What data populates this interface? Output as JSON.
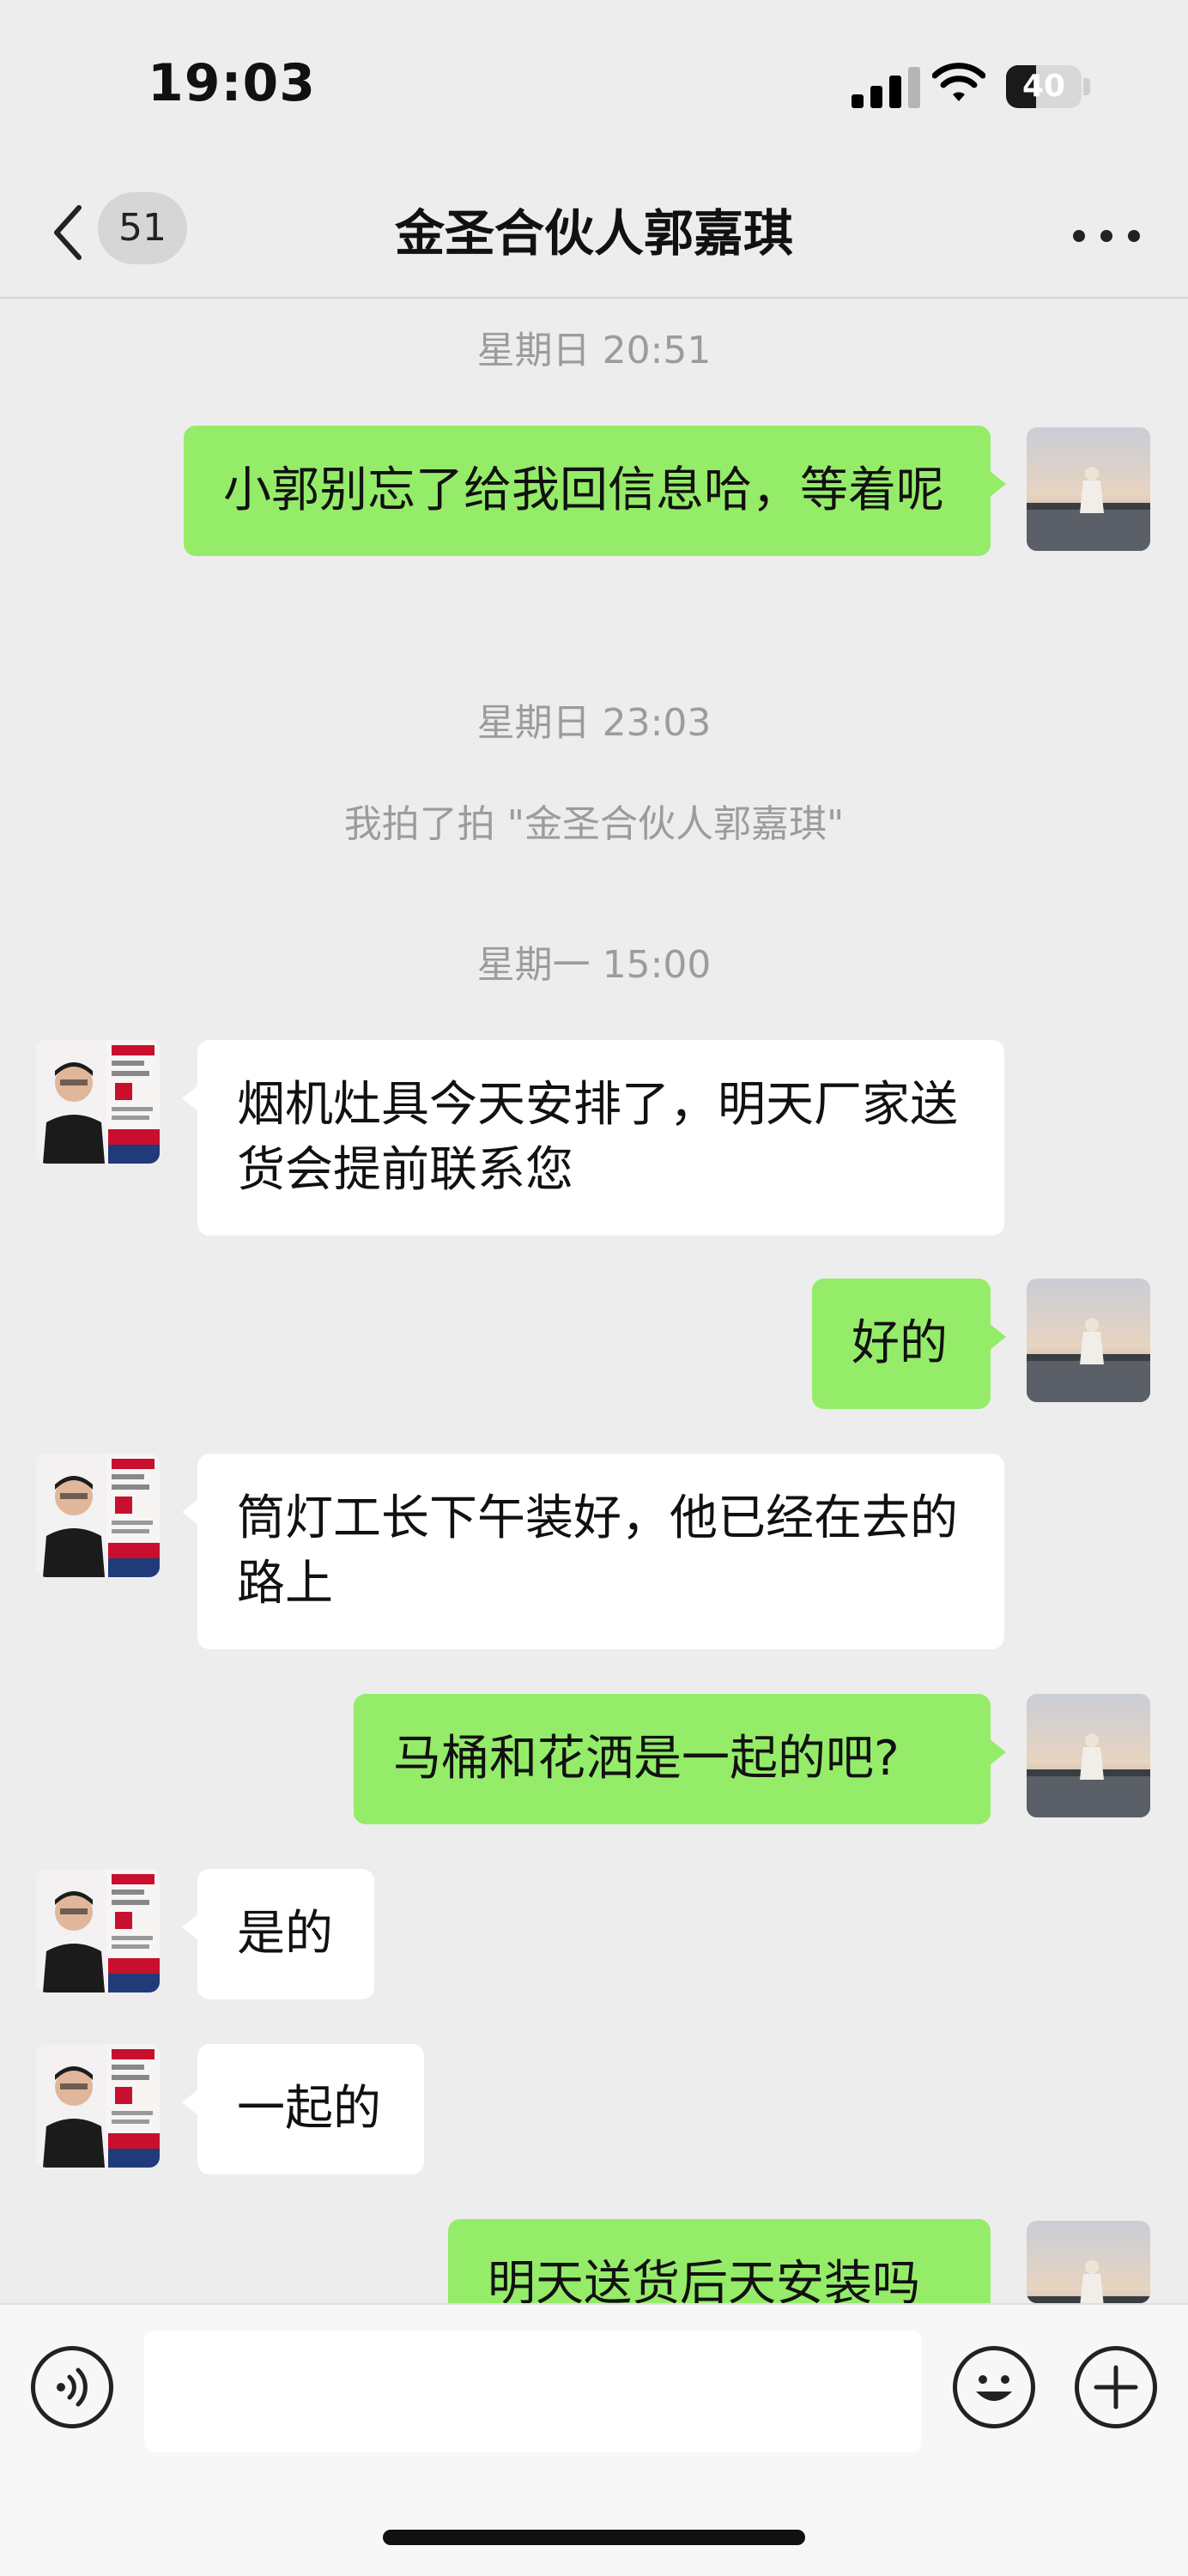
{
  "status_bar": {
    "time": "19:03",
    "battery": "40",
    "battery_level": 0.4,
    "icons": [
      "signal-icon",
      "wifi-icon",
      "battery-icon"
    ]
  },
  "nav": {
    "unread_count": "51",
    "title": "金圣合伙人郭嘉琪",
    "icons": [
      "chevron-left-icon",
      "more-icon"
    ]
  },
  "messages": [
    {
      "type": "time",
      "text": "星期日 20:51"
    },
    {
      "type": "me",
      "text": "小郭别忘了给我回信息哈，等着呢"
    },
    {
      "type": "time",
      "text": "星期日 23:03"
    },
    {
      "type": "system",
      "text": "我拍了拍 \"金圣合伙人郭嘉琪\""
    },
    {
      "type": "time",
      "text": "星期一 15:00"
    },
    {
      "type": "them",
      "text": "烟机灶具今天安排了，明天厂家送货会提前联系您"
    },
    {
      "type": "me",
      "text": "好的"
    },
    {
      "type": "them",
      "text": "筒灯工长下午装好，他已经在去的路上"
    },
    {
      "type": "me",
      "text": "马桶和花洒是一起的吧?"
    },
    {
      "type": "them",
      "text": "是的"
    },
    {
      "type": "them",
      "text": "一起的"
    },
    {
      "type": "me",
      "text": "明天送货后天安装吗"
    }
  ],
  "input_bar": {
    "value": "",
    "icons": [
      "voice-icon",
      "emoji-icon",
      "plus-icon"
    ]
  },
  "colors": {
    "background": "#ededed",
    "my_bubble": "#95ec69",
    "their_bubble": "#ffffff",
    "timestamp": "#9c9c9c"
  }
}
